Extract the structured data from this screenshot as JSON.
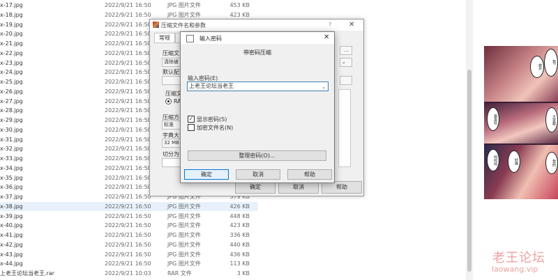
{
  "files": [
    {
      "name": "x-17.jpg",
      "date": "2022/9/21 16:50",
      "type": "JPG 图片文件",
      "size": "453 KB"
    },
    {
      "name": "x-18.jpg",
      "date": "2022/9/21 16:50",
      "type": "JPG 图片文件",
      "size": "423 KB"
    },
    {
      "name": "x-19.jpg",
      "date": "2022/9/21 16:50",
      "type": "JPG 图片文件",
      "size": ""
    },
    {
      "name": "x-20.jpg",
      "date": "2022/9/21 16:50",
      "type": "",
      "size": ""
    },
    {
      "name": "x-21.jpg",
      "date": "2022/9/21 16:50",
      "type": "",
      "size": ""
    },
    {
      "name": "x-22.jpg",
      "date": "2022/9/21 16:50",
      "type": "",
      "size": ""
    },
    {
      "name": "x-23.jpg",
      "date": "2022/9/21 16:50",
      "type": "",
      "size": ""
    },
    {
      "name": "x-24.jpg",
      "date": "2022/9/21 16:50",
      "type": "",
      "size": ""
    },
    {
      "name": "x-25.jpg",
      "date": "2022/9/21 16:50",
      "type": "",
      "size": ""
    },
    {
      "name": "x-26.jpg",
      "date": "2022/9/21 16:50",
      "type": "",
      "size": ""
    },
    {
      "name": "x-27.jpg",
      "date": "2022/9/21 16:50",
      "type": "",
      "size": ""
    },
    {
      "name": "x-28.jpg",
      "date": "2022/9/21 16:50",
      "type": "",
      "size": ""
    },
    {
      "name": "x-29.jpg",
      "date": "2022/9/21 16:50",
      "type": "",
      "size": ""
    },
    {
      "name": "x-30.jpg",
      "date": "2022/9/21 16:50",
      "type": "",
      "size": ""
    },
    {
      "name": "x-31.jpg",
      "date": "2022/9/21 16:50",
      "type": "",
      "size": ""
    },
    {
      "name": "x-32.jpg",
      "date": "2022/9/21 16:50",
      "type": "",
      "size": ""
    },
    {
      "name": "x-33.jpg",
      "date": "2022/9/21 16:50",
      "type": "",
      "size": ""
    },
    {
      "name": "x-34.jpg",
      "date": "2022/9/21 16:50",
      "type": "",
      "size": ""
    },
    {
      "name": "x-35.jpg",
      "date": "2022/9/21 16:50",
      "type": "",
      "size": ""
    },
    {
      "name": "x-36.jpg",
      "date": "2022/9/21 16:50",
      "type": "",
      "size": ""
    },
    {
      "name": "x-37.jpg",
      "date": "2022/9/21 16:50",
      "type": "JPG 图片文件",
      "size": "379 KB"
    },
    {
      "name": "x-38.jpg",
      "date": "2022/9/21 16:50",
      "type": "JPG 图片文件",
      "size": "426 KB"
    },
    {
      "name": "x-39.jpg",
      "date": "2022/9/21 16:50",
      "type": "JPG 图片文件",
      "size": "448 KB"
    },
    {
      "name": "x-40.jpg",
      "date": "2022/9/21 16:50",
      "type": "JPG 图片文件",
      "size": "423 KB"
    },
    {
      "name": "x-41.jpg",
      "date": "2022/9/21 16:50",
      "type": "JPG 图片文件",
      "size": "336 KB"
    },
    {
      "name": "x-42.jpg",
      "date": "2022/9/21 16:50",
      "type": "JPG 图片文件",
      "size": "440 KB"
    },
    {
      "name": "x-43.jpg",
      "date": "2022/9/21 16:50",
      "type": "JPG 图片文件",
      "size": "436 KB"
    },
    {
      "name": "x-44.jpg",
      "date": "2022/9/21 16:50",
      "type": "JPG 图片文件",
      "size": "113 KB"
    },
    {
      "name": "上老王论坛当老王.rar",
      "date": "2022/9/21 10:03",
      "type": "RAR 文件",
      "size": "3 KB"
    }
  ],
  "selected_file": "x-38.jpg",
  "archive_dialog": {
    "title": "压缩文件名和参数",
    "help": "?",
    "close": "✕",
    "tabs": [
      "常规",
      "高"
    ],
    "archive_name_label": "压缩文",
    "archive_name_button": "...",
    "update_field": "清除被",
    "default_config_label": "默认配",
    "format_label": "压缩文",
    "format_option": "RA",
    "method_label": "压缩方",
    "method_value": "标准",
    "dict_label": "字典大",
    "dict_value": "32 MB",
    "split_label": "切分为",
    "ok_label": "确定",
    "cancel_label": "取消",
    "help_label": "帮助"
  },
  "password_dialog": {
    "title": "输入密码",
    "heading": "带密码压缩",
    "password_label": "输入密码(E)",
    "password_value": "上老王论坛当老王",
    "show_password_label": "显示密码(S)",
    "show_password_checked": true,
    "encrypt_names_label": "加密文件名(N)",
    "encrypt_names_checked": false,
    "manage_label": "整理密码(O)...",
    "ok_label": "确定",
    "cancel_label": "取消",
    "help_label": "帮助"
  },
  "preview": {
    "bubbles": [
      "放开",
      "我!",
      "最喜欢",
      "大家都",
      "呵呵呵",
      "好痛",
      "我的"
    ]
  },
  "watermark": {
    "cn": "老王论坛",
    "en": "laowang.vip"
  },
  "colors": {
    "accent": "#0078d7",
    "selected_row": "#e8f1fb",
    "watermark": "#f0a0a0"
  }
}
